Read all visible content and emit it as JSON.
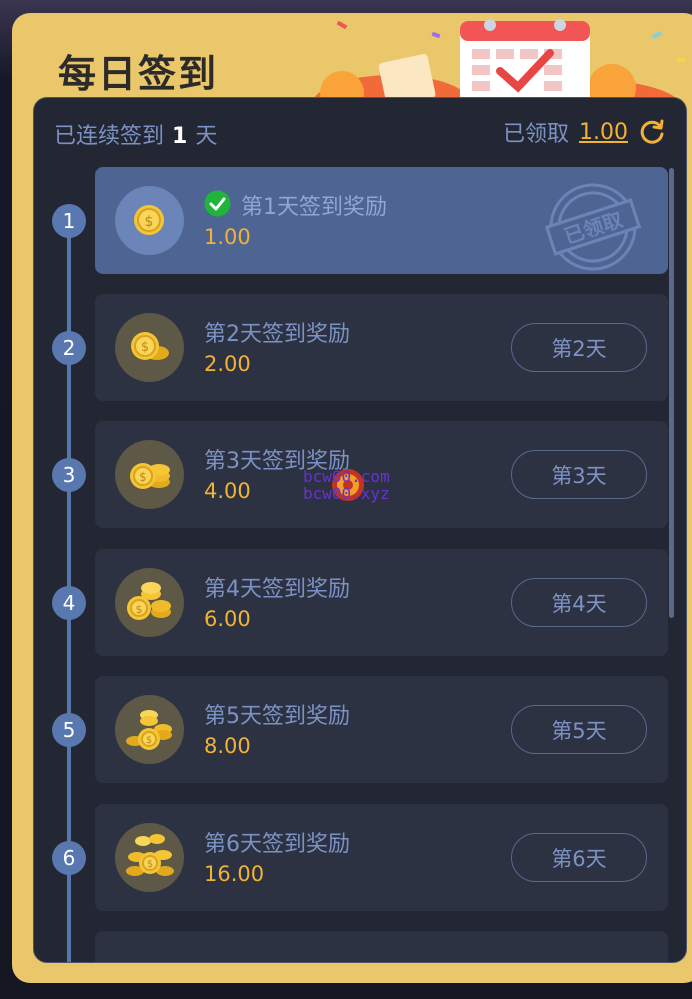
{
  "title": "每日签到",
  "header": {
    "streak_prefix": "已连续签到",
    "streak_days": "1",
    "streak_unit": "天",
    "claimed_label": "已领取",
    "claimed_amount": "1.00",
    "refresh_icon": "refresh-icon"
  },
  "days": [
    {
      "step": "1",
      "title": "第1天签到奖励",
      "amount": "1.00",
      "status": "claimed",
      "stamp": "已领取"
    },
    {
      "step": "2",
      "title": "第2天签到奖励",
      "amount": "2.00",
      "button": "第2天"
    },
    {
      "step": "3",
      "title": "第3天签到奖励",
      "amount": "4.00",
      "button": "第3天"
    },
    {
      "step": "4",
      "title": "第4天签到奖励",
      "amount": "6.00",
      "button": "第4天"
    },
    {
      "step": "5",
      "title": "第5天签到奖励",
      "amount": "8.00",
      "button": "第5天"
    },
    {
      "step": "6",
      "title": "第6天签到奖励",
      "amount": "16.00",
      "button": "第6天"
    }
  ],
  "watermark": {
    "line1": "bcw00.com",
    "line2": "bcw00.xyz"
  },
  "colors": {
    "accent": "#f2b233",
    "panel": "#e9c76a",
    "card": "#2d3243",
    "card_active": "#4e6493",
    "text_muted": "#7d92c4"
  }
}
